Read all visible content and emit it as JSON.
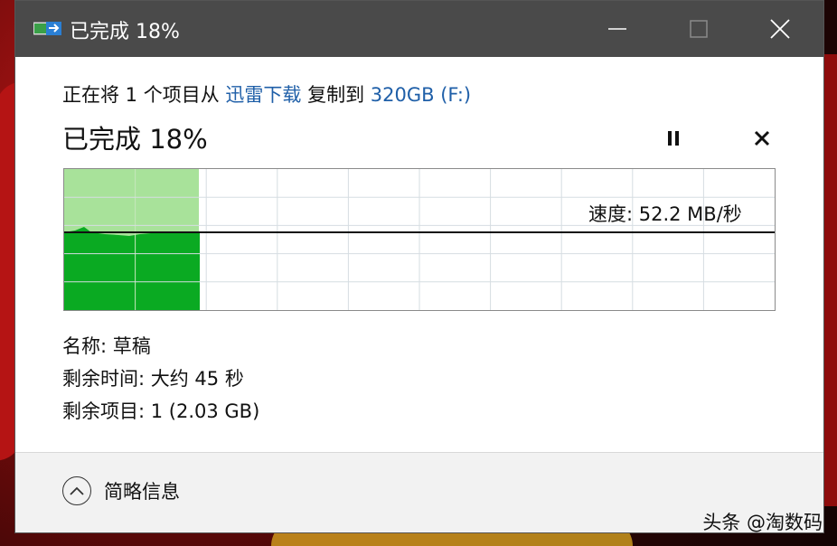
{
  "window": {
    "title": "已完成 18%"
  },
  "header": {
    "prefix": "正在将 1 个项目从 ",
    "source": "迅雷下载",
    "middle": " 复制到 ",
    "destination": "320GB (F:)"
  },
  "status": {
    "text": "已完成 18%",
    "progress_percent": 18
  },
  "graph": {
    "speed_label": "速度: 52.2 MB/秒"
  },
  "details": {
    "name_label": "名称: 草稿",
    "time_left_label": "剩余时间: 大约 45 秒",
    "items_left_label": "剩余项目: 1 (2.03 GB)"
  },
  "footer": {
    "collapse_label": "简略信息"
  },
  "watermark": {
    "text": "头条 @淘数码"
  },
  "colors": {
    "titlebar": "#4a4a4a",
    "progress_light": "#a8e29a",
    "progress_dark": "#0aaa22",
    "link": "#1f5fa8"
  }
}
